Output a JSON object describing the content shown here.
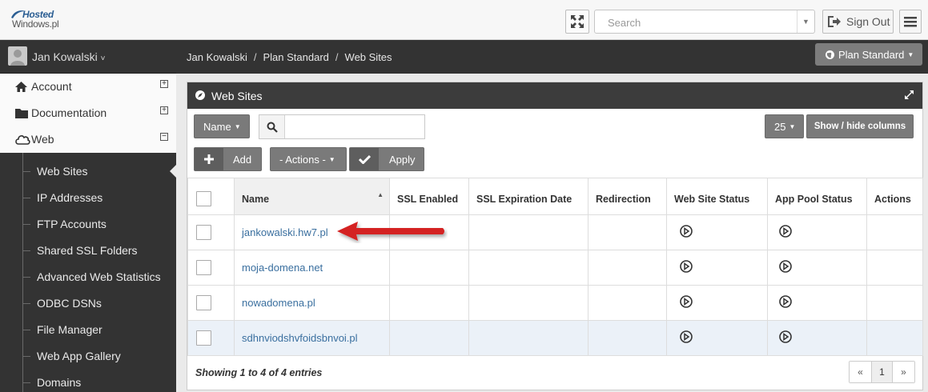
{
  "header": {
    "logo_line1": "Hosted",
    "logo_line2": "Windows.pl",
    "search_placeholder": "Search",
    "sign_out_label": "Sign Out"
  },
  "user": {
    "name": "Jan Kowalski"
  },
  "nav": {
    "items": [
      {
        "label": "Account",
        "icon": "home-icon",
        "toggle": "+"
      },
      {
        "label": "Documentation",
        "icon": "folder-icon",
        "toggle": "+"
      },
      {
        "label": "Web",
        "icon": "cloud-icon",
        "toggle": "−"
      }
    ],
    "sub_items": [
      {
        "label": "Web Sites",
        "active": true
      },
      {
        "label": "IP Addresses"
      },
      {
        "label": "FTP Accounts"
      },
      {
        "label": "Shared SSL Folders"
      },
      {
        "label": "Advanced Web Statistics"
      },
      {
        "label": "ODBC DSNs"
      },
      {
        "label": "File Manager"
      },
      {
        "label": "Web App Gallery"
      },
      {
        "label": "Domains"
      }
    ]
  },
  "breadcrumb": {
    "items": [
      "Jan Kowalski",
      "Plan Standard",
      "Web Sites"
    ],
    "separator": "/"
  },
  "plan_button": {
    "label": "Plan Standard"
  },
  "panel": {
    "title": "Web Sites",
    "filter_button": "Name",
    "search_value": "",
    "page_size": "25",
    "columns_button": "Show / hide columns",
    "add_button": "Add",
    "bulk_actions": "- Actions -",
    "apply_button": "Apply"
  },
  "table": {
    "columns": [
      "Name",
      "SSL Enabled",
      "SSL Expiration Date",
      "Redirection",
      "Web Site Status",
      "App Pool Status",
      "Actions"
    ],
    "rows": [
      {
        "name": "jankowalski.hw7.pl",
        "ssl_enabled": "",
        "ssl_expiration": "",
        "redirection": "",
        "web_status": "play-icon",
        "pool_status": "play-icon"
      },
      {
        "name": "moja-domena.net",
        "ssl_enabled": "",
        "ssl_expiration": "",
        "redirection": "",
        "web_status": "play-icon",
        "pool_status": "play-icon"
      },
      {
        "name": "nowadomena.pl",
        "ssl_enabled": "",
        "ssl_expiration": "",
        "redirection": "",
        "web_status": "play-icon",
        "pool_status": "play-icon"
      },
      {
        "name": "sdhnviodshvfoidsbnvoi.pl",
        "ssl_enabled": "",
        "ssl_expiration": "",
        "redirection": "",
        "web_status": "play-icon",
        "pool_status": "play-icon"
      }
    ]
  },
  "footer": {
    "info": "Showing 1 to 4 of 4 entries",
    "pager": {
      "prev": "«",
      "current": "1",
      "next": "»"
    }
  },
  "colors": {
    "accent_link": "#3a6f9f",
    "annotation_arrow": "#d42020",
    "dark_bar": "#333333"
  }
}
